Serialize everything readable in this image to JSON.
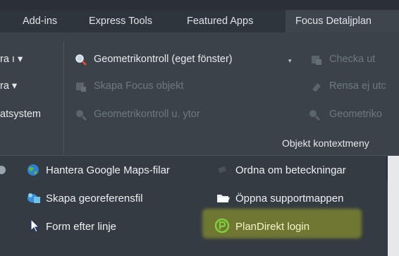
{
  "tabs": [
    {
      "label": "Add-ins"
    },
    {
      "label": "Express Tools"
    },
    {
      "label": "Featured Apps"
    },
    {
      "label": "Focus Detaljplan"
    }
  ],
  "ribbon": {
    "left_col": [
      "ra ı ▾",
      "ra ▾",
      "atsystem"
    ],
    "mid_col": [
      {
        "label": "Geometrikontroll (eget fönster)",
        "enabled": true
      },
      {
        "label": "Skapa Focus objekt",
        "enabled": false
      },
      {
        "label": "Geometrikontroll u. ytor",
        "enabled": false
      }
    ],
    "right_col": [
      {
        "label": "Checka ut",
        "enabled": false
      },
      {
        "label": "Rensa ej utc",
        "enabled": false
      },
      {
        "label": "Geometriko",
        "enabled": false
      }
    ],
    "dropdown_caret": "▾",
    "group_label": "Objekt kontextmeny"
  },
  "menu": {
    "left": [
      {
        "label": "Hantera Google Maps-filar",
        "icon": "globe-icon"
      },
      {
        "label": "Skapa georeferensfil",
        "icon": "georef-icon"
      },
      {
        "label": "Form efter linje",
        "icon": "cursor-icon"
      }
    ],
    "right": [
      {
        "label": "Ordna om beteckningar",
        "icon": "arrange-icon"
      },
      {
        "label": "Öppna supportmappen",
        "icon": "folder-icon"
      },
      {
        "label": "PlanDirekt login",
        "icon": "plandirekt-icon"
      }
    ]
  },
  "colors": {
    "highlight": "#a0aa28",
    "accent_green": "#7fd13b"
  }
}
